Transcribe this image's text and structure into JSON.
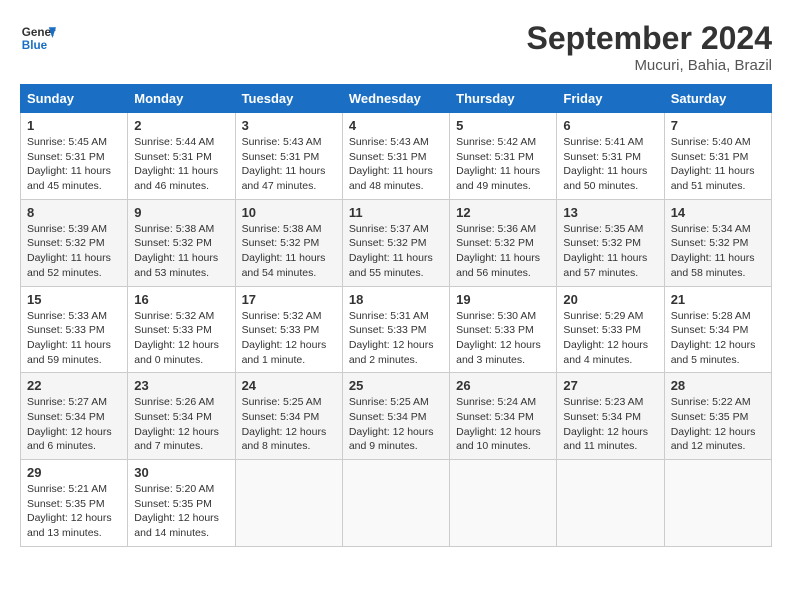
{
  "header": {
    "logo_line1": "General",
    "logo_line2": "Blue",
    "month_title": "September 2024",
    "subtitle": "Mucuri, Bahia, Brazil"
  },
  "weekdays": [
    "Sunday",
    "Monday",
    "Tuesday",
    "Wednesday",
    "Thursday",
    "Friday",
    "Saturday"
  ],
  "weeks": [
    [
      {
        "day": "1",
        "sunrise": "5:45 AM",
        "sunset": "5:31 PM",
        "daylight": "11 hours and 45 minutes."
      },
      {
        "day": "2",
        "sunrise": "5:44 AM",
        "sunset": "5:31 PM",
        "daylight": "11 hours and 46 minutes."
      },
      {
        "day": "3",
        "sunrise": "5:43 AM",
        "sunset": "5:31 PM",
        "daylight": "11 hours and 47 minutes."
      },
      {
        "day": "4",
        "sunrise": "5:43 AM",
        "sunset": "5:31 PM",
        "daylight": "11 hours and 48 minutes."
      },
      {
        "day": "5",
        "sunrise": "5:42 AM",
        "sunset": "5:31 PM",
        "daylight": "11 hours and 49 minutes."
      },
      {
        "day": "6",
        "sunrise": "5:41 AM",
        "sunset": "5:31 PM",
        "daylight": "11 hours and 50 minutes."
      },
      {
        "day": "7",
        "sunrise": "5:40 AM",
        "sunset": "5:31 PM",
        "daylight": "11 hours and 51 minutes."
      }
    ],
    [
      {
        "day": "8",
        "sunrise": "5:39 AM",
        "sunset": "5:32 PM",
        "daylight": "11 hours and 52 minutes."
      },
      {
        "day": "9",
        "sunrise": "5:38 AM",
        "sunset": "5:32 PM",
        "daylight": "11 hours and 53 minutes."
      },
      {
        "day": "10",
        "sunrise": "5:38 AM",
        "sunset": "5:32 PM",
        "daylight": "11 hours and 54 minutes."
      },
      {
        "day": "11",
        "sunrise": "5:37 AM",
        "sunset": "5:32 PM",
        "daylight": "11 hours and 55 minutes."
      },
      {
        "day": "12",
        "sunrise": "5:36 AM",
        "sunset": "5:32 PM",
        "daylight": "11 hours and 56 minutes."
      },
      {
        "day": "13",
        "sunrise": "5:35 AM",
        "sunset": "5:32 PM",
        "daylight": "11 hours and 57 minutes."
      },
      {
        "day": "14",
        "sunrise": "5:34 AM",
        "sunset": "5:32 PM",
        "daylight": "11 hours and 58 minutes."
      }
    ],
    [
      {
        "day": "15",
        "sunrise": "5:33 AM",
        "sunset": "5:33 PM",
        "daylight": "11 hours and 59 minutes."
      },
      {
        "day": "16",
        "sunrise": "5:32 AM",
        "sunset": "5:33 PM",
        "daylight": "12 hours and 0 minutes."
      },
      {
        "day": "17",
        "sunrise": "5:32 AM",
        "sunset": "5:33 PM",
        "daylight": "12 hours and 1 minute."
      },
      {
        "day": "18",
        "sunrise": "5:31 AM",
        "sunset": "5:33 PM",
        "daylight": "12 hours and 2 minutes."
      },
      {
        "day": "19",
        "sunrise": "5:30 AM",
        "sunset": "5:33 PM",
        "daylight": "12 hours and 3 minutes."
      },
      {
        "day": "20",
        "sunrise": "5:29 AM",
        "sunset": "5:33 PM",
        "daylight": "12 hours and 4 minutes."
      },
      {
        "day": "21",
        "sunrise": "5:28 AM",
        "sunset": "5:34 PM",
        "daylight": "12 hours and 5 minutes."
      }
    ],
    [
      {
        "day": "22",
        "sunrise": "5:27 AM",
        "sunset": "5:34 PM",
        "daylight": "12 hours and 6 minutes."
      },
      {
        "day": "23",
        "sunrise": "5:26 AM",
        "sunset": "5:34 PM",
        "daylight": "12 hours and 7 minutes."
      },
      {
        "day": "24",
        "sunrise": "5:25 AM",
        "sunset": "5:34 PM",
        "daylight": "12 hours and 8 minutes."
      },
      {
        "day": "25",
        "sunrise": "5:25 AM",
        "sunset": "5:34 PM",
        "daylight": "12 hours and 9 minutes."
      },
      {
        "day": "26",
        "sunrise": "5:24 AM",
        "sunset": "5:34 PM",
        "daylight": "12 hours and 10 minutes."
      },
      {
        "day": "27",
        "sunrise": "5:23 AM",
        "sunset": "5:34 PM",
        "daylight": "12 hours and 11 minutes."
      },
      {
        "day": "28",
        "sunrise": "5:22 AM",
        "sunset": "5:35 PM",
        "daylight": "12 hours and 12 minutes."
      }
    ],
    [
      {
        "day": "29",
        "sunrise": "5:21 AM",
        "sunset": "5:35 PM",
        "daylight": "12 hours and 13 minutes."
      },
      {
        "day": "30",
        "sunrise": "5:20 AM",
        "sunset": "5:35 PM",
        "daylight": "12 hours and 14 minutes."
      },
      null,
      null,
      null,
      null,
      null
    ]
  ]
}
